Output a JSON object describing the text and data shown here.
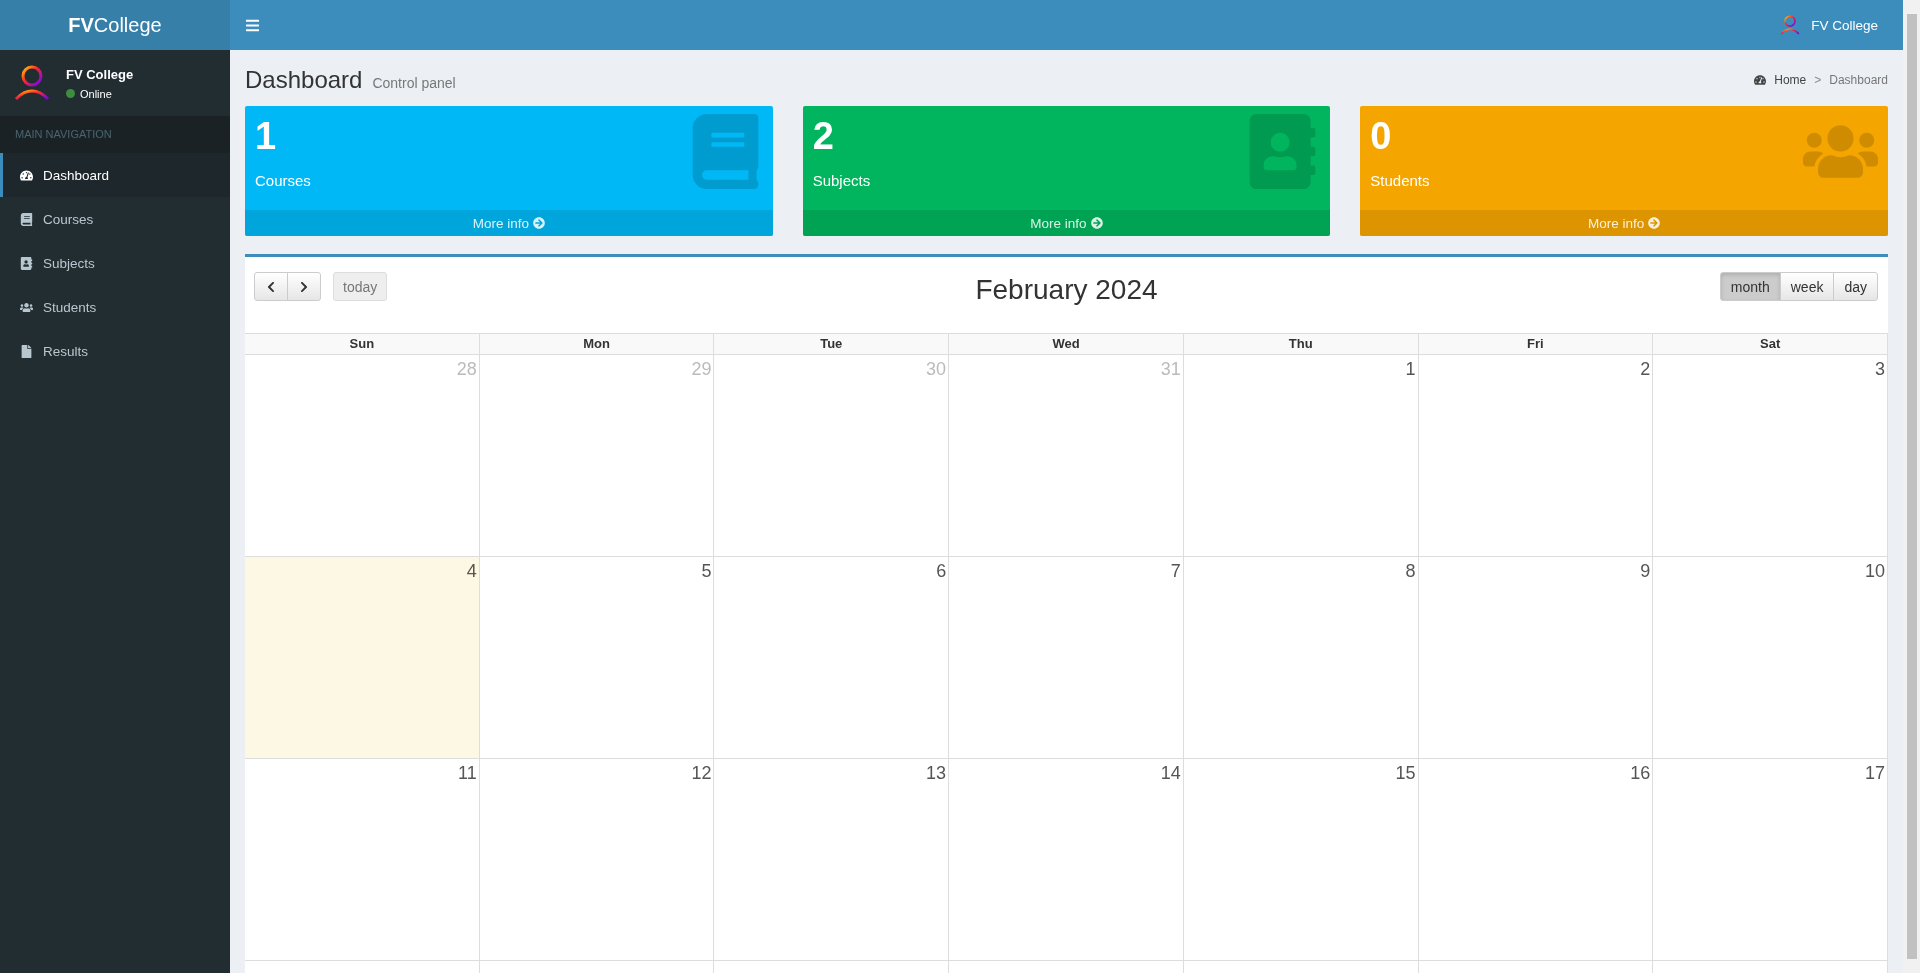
{
  "brand": {
    "bold": "FV",
    "rest": "College"
  },
  "topbar": {
    "user": "FV College"
  },
  "user_panel": {
    "name": "FV College",
    "status": "Online"
  },
  "nav_header": "MAIN NAVIGATION",
  "nav": [
    {
      "label": "Dashboard",
      "selected": true
    },
    {
      "label": "Courses",
      "selected": false
    },
    {
      "label": "Subjects",
      "selected": false
    },
    {
      "label": "Students",
      "selected": false
    },
    {
      "label": "Results",
      "selected": false
    }
  ],
  "page": {
    "title": "Dashboard",
    "subtitle": "Control panel"
  },
  "breadcrumb": [
    {
      "label": "Home"
    },
    {
      "label": "Dashboard"
    }
  ],
  "breadcrumb_separator": ">",
  "info_boxes": [
    {
      "count": "1",
      "label": "Courses",
      "link": "More info",
      "color": "#00b8f5"
    },
    {
      "count": "2",
      "label": "Subjects",
      "link": "More info",
      "color": "#00b55e"
    },
    {
      "count": "0",
      "label": "Students",
      "link": "More info",
      "color": "#f5a500"
    }
  ],
  "calendar": {
    "title": "February 2024",
    "today_button": "today",
    "views": [
      {
        "label": "month",
        "selected": true
      },
      {
        "label": "week",
        "selected": false
      },
      {
        "label": "day",
        "selected": false
      }
    ],
    "weekdays": [
      "Sun",
      "Mon",
      "Tue",
      "Wed",
      "Thu",
      "Fri",
      "Sat"
    ],
    "weeks": [
      [
        {
          "day": "28",
          "other_month": true,
          "today": false
        },
        {
          "day": "29",
          "other_month": true,
          "today": false
        },
        {
          "day": "30",
          "other_month": true,
          "today": false
        },
        {
          "day": "31",
          "other_month": true,
          "today": false
        },
        {
          "day": "1",
          "other_month": false,
          "today": false
        },
        {
          "day": "2",
          "other_month": false,
          "today": false
        },
        {
          "day": "3",
          "other_month": false,
          "today": false
        }
      ],
      [
        {
          "day": "4",
          "other_month": false,
          "today": true
        },
        {
          "day": "5",
          "other_month": false,
          "today": false
        },
        {
          "day": "6",
          "other_month": false,
          "today": false
        },
        {
          "day": "7",
          "other_month": false,
          "today": false
        },
        {
          "day": "8",
          "other_month": false,
          "today": false
        },
        {
          "day": "9",
          "other_month": false,
          "today": false
        },
        {
          "day": "10",
          "other_month": false,
          "today": false
        }
      ],
      [
        {
          "day": "11",
          "other_month": false,
          "today": false
        },
        {
          "day": "12",
          "other_month": false,
          "today": false
        },
        {
          "day": "13",
          "other_month": false,
          "today": false
        },
        {
          "day": "14",
          "other_month": false,
          "today": false
        },
        {
          "day": "15",
          "other_month": false,
          "today": false
        },
        {
          "day": "16",
          "other_month": false,
          "today": false
        },
        {
          "day": "17",
          "other_month": false,
          "today": false
        }
      ]
    ]
  }
}
